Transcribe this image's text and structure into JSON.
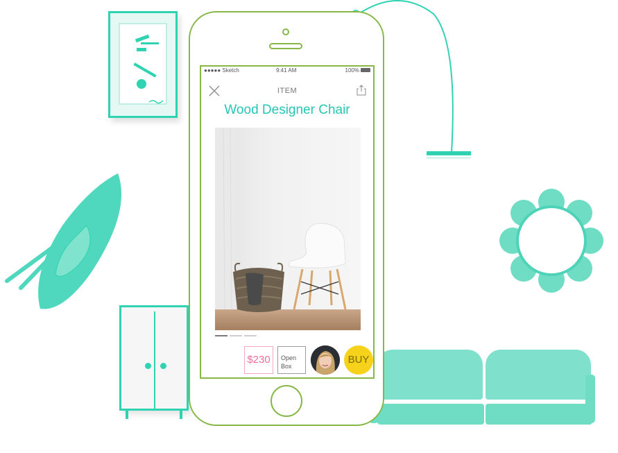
{
  "status_bar": {
    "carrier": "●●●●● Sketch",
    "time": "9:41 AM",
    "battery": "100%"
  },
  "nav": {
    "title": "ITEM",
    "close_icon": "close-icon",
    "share_icon": "share-icon"
  },
  "product": {
    "title": "Wood Designer Chair",
    "gallery_pages": 3,
    "gallery_current": 1
  },
  "actions": {
    "price": "$230",
    "condition": "Open Box",
    "buy_label": "BUY"
  },
  "colors": {
    "accent_teal": "#2fd3b2",
    "title_teal": "#25c7b2",
    "phone_outline": "#86b847",
    "price_pink": "#ee6f98",
    "buy_yellow": "#f7d21b"
  }
}
